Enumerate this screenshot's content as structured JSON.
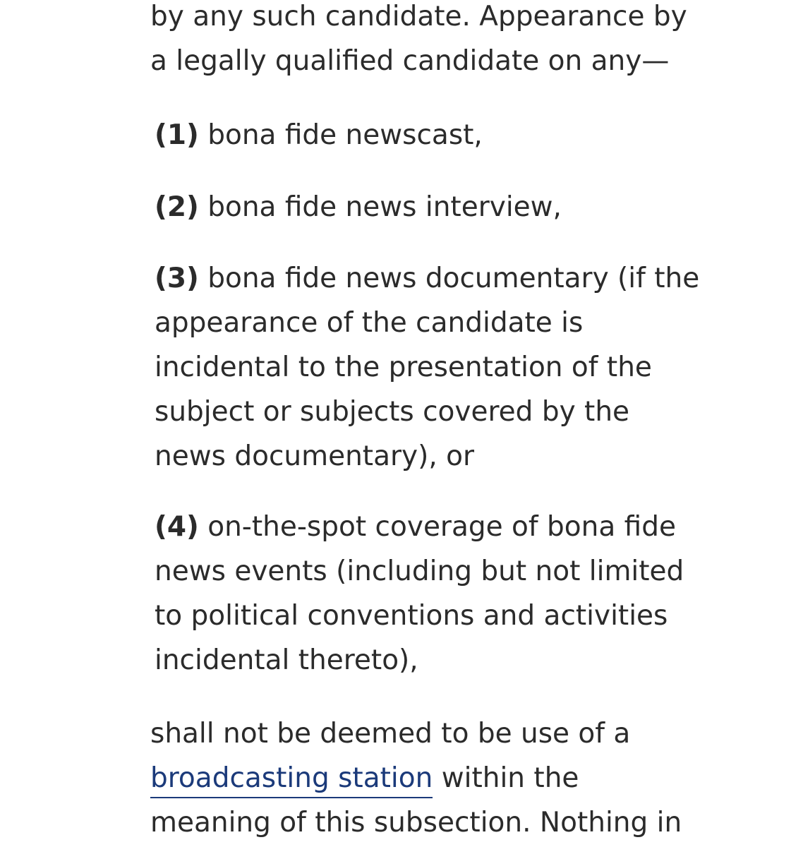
{
  "intro": {
    "line1": "by any such candidate. Appearance by",
    "line2": "a legally qualified candidate on any—"
  },
  "items": [
    {
      "number": "(1)",
      "lines": [
        "bona fide newscast,"
      ]
    },
    {
      "number": "(2)",
      "lines": [
        "bona fide news interview,"
      ]
    },
    {
      "number": "(3)",
      "lines": [
        "bona fide news documentary (if the",
        "appearance of the candidate is",
        "incidental to the presentation of the",
        "subject or subjects covered by the",
        "news documentary), or"
      ]
    },
    {
      "number": "(4)",
      "lines": [
        "on-the-spot coverage of bona fide",
        "news events (including but not limited",
        "to political conventions and activities",
        "incidental thereto),"
      ]
    }
  ],
  "closing": {
    "line1": "shall not be deemed to be use of a",
    "link_text": "broadcasting station",
    "line2_rest": "within the",
    "line3": "meaning of this subsection. Nothing in"
  },
  "colors": {
    "text": "#2b2b2b",
    "link": "#1b3a7a",
    "background": "#ffffff"
  }
}
